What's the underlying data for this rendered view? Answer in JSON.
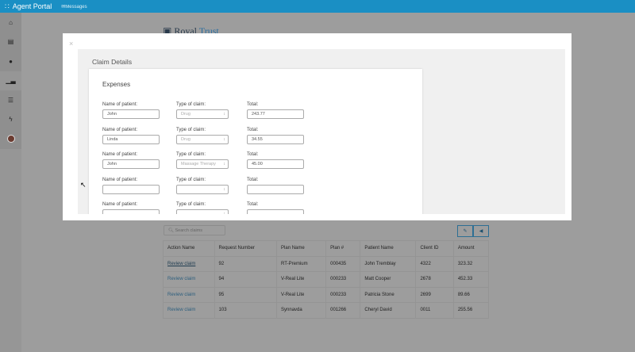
{
  "app": {
    "title": "Agent Portal",
    "messages": "Messages",
    "logo_prefix": "Royal",
    "logo_suffix": "Trust"
  },
  "sidebar": {
    "icons": [
      "home-icon",
      "document-icon",
      "globe-icon",
      "chart-icon",
      "list-icon",
      "bolt-icon",
      "avatar"
    ]
  },
  "modal": {
    "close": "×",
    "title": "Claim Details",
    "section": "Expenses",
    "labels": {
      "name": "Name of patient:",
      "type": "Type of claim:",
      "total": "Total:"
    },
    "rows": [
      {
        "name": "John",
        "type": "Drug",
        "total": "243.77"
      },
      {
        "name": "Linda",
        "type": "Drug",
        "total": "34.55"
      },
      {
        "name": "John",
        "type": "Massage Therapy",
        "total": "45.00"
      },
      {
        "name": "",
        "type": "",
        "total": ""
      },
      {
        "name": "",
        "type": "",
        "total": ""
      }
    ]
  },
  "claims": {
    "search_placeholder": "Search claims",
    "headers": [
      "Action Name",
      "Request Number",
      "Plan Name",
      "Plan #",
      "Patient Name",
      "Client ID",
      "Amount"
    ],
    "rows": [
      [
        "Review claim",
        "92",
        "RT-Premium",
        "000435",
        "John Tremblay",
        "4322",
        "323.32"
      ],
      [
        "Review claim",
        "94",
        "V-Real Lite",
        "000233",
        "Matt Cooper",
        "2678",
        "452.33"
      ],
      [
        "Review claim",
        "95",
        "V-Real Lite",
        "000233",
        "Patricia Stone",
        "2699",
        "89.66"
      ],
      [
        "Review claim",
        "103",
        "Synnavda",
        "001266",
        "Cheryl David",
        "0011",
        "255.56"
      ]
    ]
  }
}
